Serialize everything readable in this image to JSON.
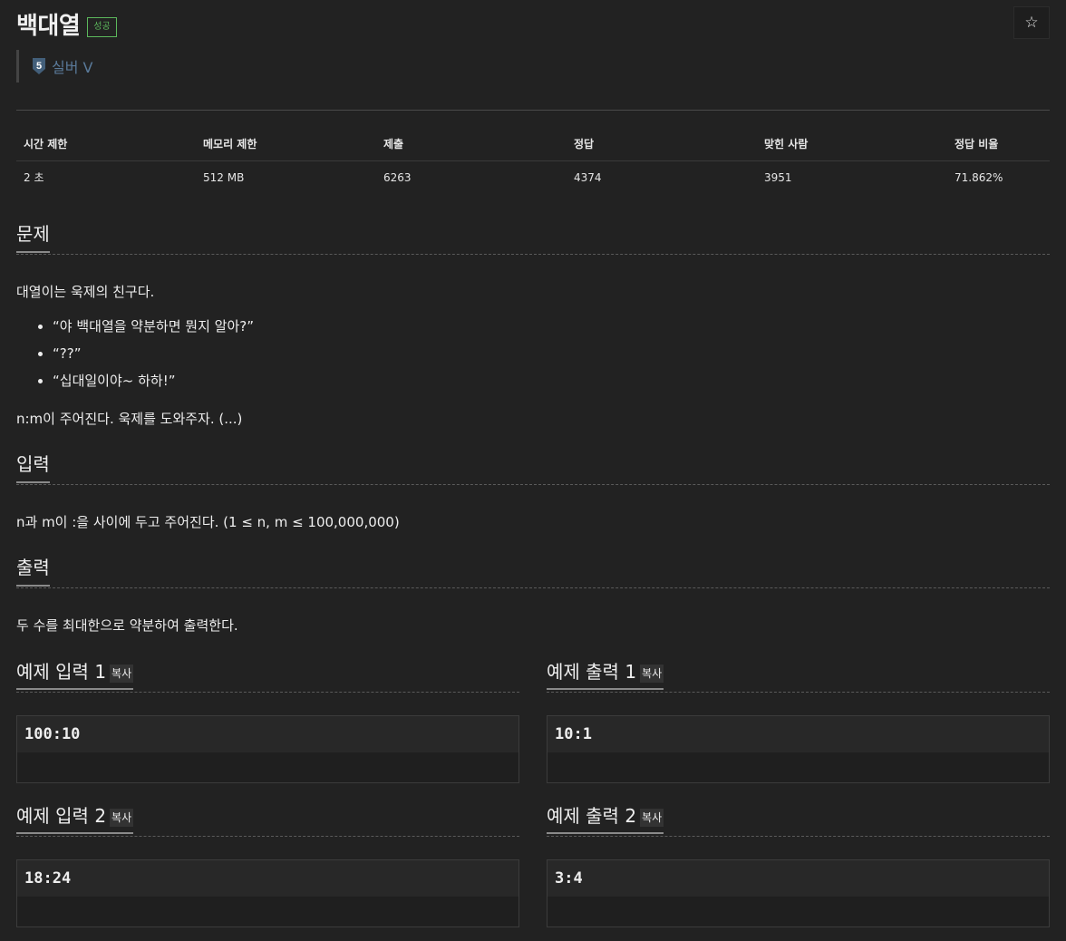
{
  "problem": {
    "title": "백대열",
    "status_badge": "성공",
    "tier": "실버 V",
    "tier_number": "5",
    "star_icon": "☆"
  },
  "stats": {
    "headers": [
      "시간 제한",
      "메모리 제한",
      "제출",
      "정답",
      "맞힌 사람",
      "정답 비율"
    ],
    "values": [
      "2 초",
      "512 MB",
      "6263",
      "4374",
      "3951",
      "71.862%"
    ]
  },
  "sections": {
    "problem_title": "문제",
    "problem_intro": "대열이는 욱제의 친구다.",
    "problem_bullets": [
      "“야 백대열을 약분하면 뭔지 알아?”",
      "“??”",
      "“십대일이야~ 하하!”"
    ],
    "problem_outro": "n:m이 주어진다. 욱제를 도와주자. (...)",
    "input_title": "입력",
    "input_text": "n과 m이 :을 사이에 두고 주어진다. (1 ≤ n, m ≤ 100,000,000)",
    "output_title": "출력",
    "output_text": "두 수를 최대한으로 약분하여 출력한다."
  },
  "samples": {
    "copy_label": "복사",
    "input1_title": "예제 입력 1",
    "input1_value": "100:10",
    "output1_title": "예제 출력 1",
    "output1_value": "10:1",
    "input2_title": "예제 입력 2",
    "input2_value": "18:24",
    "output2_title": "예제 출력 2",
    "output2_value": "3:4"
  }
}
